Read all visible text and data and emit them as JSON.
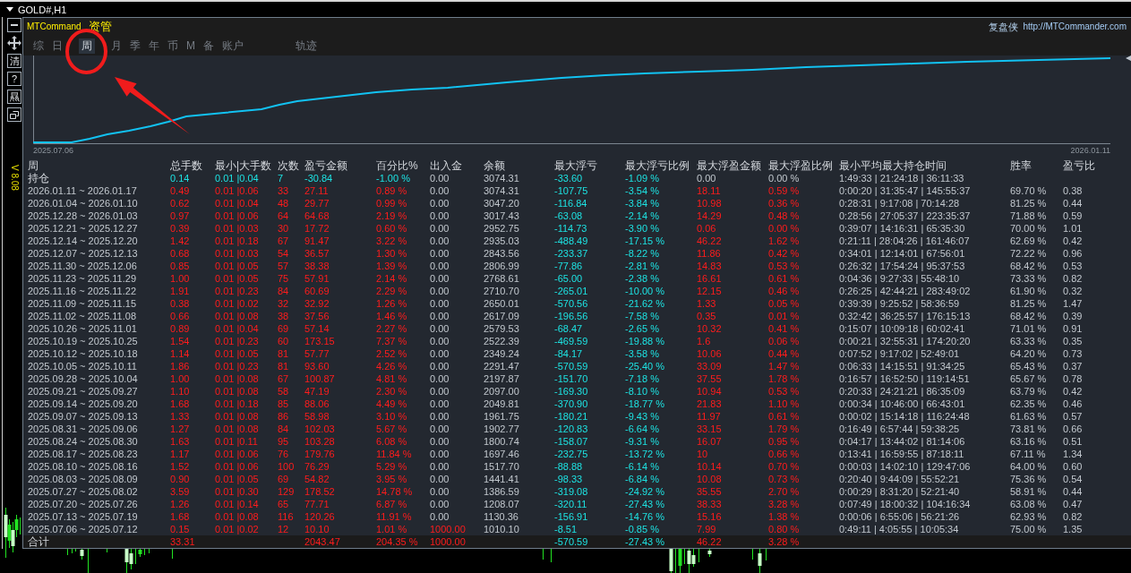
{
  "window": {
    "title": "GOLD#,H1"
  },
  "side_toolbar": {
    "buttons": [
      {
        "kind": "minimize"
      },
      {
        "kind": "move"
      },
      {
        "kind": "text",
        "label": "清"
      },
      {
        "kind": "text",
        "label": "?"
      },
      {
        "kind": "text",
        "label": "㬎"
      },
      {
        "kind": "restore"
      }
    ],
    "version": "V 8.08"
  },
  "header": {
    "app_name": "MTCommand",
    "app_name_suffix": "资管",
    "brand": "复盘侠",
    "url": "http://MTCommander.com"
  },
  "tabs": [
    {
      "label": "综",
      "selected": false
    },
    {
      "label": "日",
      "selected": false
    },
    {
      "label": "周",
      "selected": true
    },
    {
      "label": "月",
      "selected": false
    },
    {
      "label": "季",
      "selected": false
    },
    {
      "label": "年",
      "selected": false
    },
    {
      "label": "币",
      "selected": false
    },
    {
      "label": "M",
      "selected": false
    },
    {
      "label": "备",
      "selected": false
    },
    {
      "label": "账户",
      "selected": false
    }
  ],
  "chart": {
    "toggle_label": "轨迹",
    "x_start": "2025.07.06",
    "x_end": "2026.01.11"
  },
  "table": {
    "columns": [
      "周",
      "总手数",
      "最小|大手数",
      "次数",
      "盈亏金额",
      "百分比%",
      "出入金",
      "余额",
      "最大浮亏",
      "最大浮亏比例",
      "最大浮盈金额",
      "最大浮盈比例",
      "最小平均最大持仓时间",
      "胜率",
      "盈亏比"
    ],
    "rows": [
      {
        "kind": "position",
        "label": "持仓",
        "in_profit": false,
        "flow_in": false,
        "runup_gain": false,
        "lots": "0.14",
        "lot_range": "0.01 |0.04",
        "trades": "7",
        "pnl": "-30.84",
        "pct": "-1.00 %",
        "flow": "0.00",
        "balance": "3074.31",
        "dd": "-33.60",
        "dd_pct": "-1.09 %",
        "runup": "0.00",
        "runup_pct": "0.00 %",
        "hold": "1:49:33 | 21:24:18 | 36:11:33"
      },
      {
        "kind": "week",
        "label": "2026.01.11 ~ 2026.01.17",
        "in_profit": true,
        "flow_in": false,
        "runup_gain": true,
        "lots": "0.49",
        "lot_range": "0.01 |0.06",
        "trades": "33",
        "pnl": "27.11",
        "pct": "0.89 %",
        "flow": "0.00",
        "balance": "3074.31",
        "dd": "-107.75",
        "dd_pct": "-3.54 %",
        "runup": "18.11",
        "runup_pct": "0.59 %",
        "hold": "0:00:20 | 31:35:47 | 145:55:37",
        "win_rate": "69.70 %",
        "pl_ratio": "0.38"
      },
      {
        "kind": "week",
        "label": "2026.01.04 ~ 2026.01.10",
        "in_profit": true,
        "flow_in": false,
        "runup_gain": true,
        "lots": "0.62",
        "lot_range": "0.01 |0.04",
        "trades": "48",
        "pnl": "29.77",
        "pct": "0.99 %",
        "flow": "0.00",
        "balance": "3047.20",
        "dd": "-116.84",
        "dd_pct": "-3.84 %",
        "runup": "10.98",
        "runup_pct": "0.36 %",
        "hold": "0:28:31 | 9:17:08 | 70:14:28",
        "win_rate": "81.25 %",
        "pl_ratio": "0.44"
      },
      {
        "kind": "week",
        "label": "2025.12.28 ~ 2026.01.03",
        "in_profit": true,
        "flow_in": false,
        "runup_gain": true,
        "lots": "0.97",
        "lot_range": "0.01 |0.06",
        "trades": "64",
        "pnl": "64.68",
        "pct": "2.19 %",
        "flow": "0.00",
        "balance": "3017.43",
        "dd": "-63.08",
        "dd_pct": "-2.14 %",
        "runup": "14.29",
        "runup_pct": "0.48 %",
        "hold": "0:28:56 | 27:05:37 | 223:35:37",
        "win_rate": "71.88 %",
        "pl_ratio": "0.59"
      },
      {
        "kind": "week",
        "label": "2025.12.21 ~ 2025.12.27",
        "in_profit": true,
        "flow_in": false,
        "runup_gain": true,
        "lots": "0.39",
        "lot_range": "0.01 |0.03",
        "trades": "30",
        "pnl": "17.72",
        "pct": "0.60 %",
        "flow": "0.00",
        "balance": "2952.75",
        "dd": "-114.73",
        "dd_pct": "-3.90 %",
        "runup": "0.06",
        "runup_pct": "0.00 %",
        "hold": "0:39:07 | 14:16:31 | 65:35:30",
        "win_rate": "70.00 %",
        "pl_ratio": "1.01"
      },
      {
        "kind": "week",
        "label": "2025.12.14 ~ 2025.12.20",
        "in_profit": true,
        "flow_in": false,
        "runup_gain": true,
        "lots": "1.42",
        "lot_range": "0.01 |0.18",
        "trades": "67",
        "pnl": "91.47",
        "pct": "3.22 %",
        "flow": "0.00",
        "balance": "2935.03",
        "dd": "-488.49",
        "dd_pct": "-17.15 %",
        "runup": "46.22",
        "runup_pct": "1.62 %",
        "hold": "0:21:11 | 28:04:26 | 161:46:07",
        "win_rate": "62.69 %",
        "pl_ratio": "0.42"
      },
      {
        "kind": "week",
        "label": "2025.12.07 ~ 2025.12.13",
        "in_profit": true,
        "flow_in": false,
        "runup_gain": true,
        "lots": "0.68",
        "lot_range": "0.01 |0.03",
        "trades": "54",
        "pnl": "36.57",
        "pct": "1.30 %",
        "flow": "0.00",
        "balance": "2843.56",
        "dd": "-233.37",
        "dd_pct": "-8.22 %",
        "runup": "11.86",
        "runup_pct": "0.42 %",
        "hold": "0:34:01 | 12:14:01 | 67:56:01",
        "win_rate": "72.22 %",
        "pl_ratio": "0.96"
      },
      {
        "kind": "week",
        "label": "2025.11.30 ~ 2025.12.06",
        "in_profit": true,
        "flow_in": false,
        "runup_gain": true,
        "lots": "0.85",
        "lot_range": "0.01 |0.05",
        "trades": "57",
        "pnl": "38.38",
        "pct": "1.39 %",
        "flow": "0.00",
        "balance": "2806.99",
        "dd": "-77.86",
        "dd_pct": "-2.81 %",
        "runup": "14.83",
        "runup_pct": "0.53 %",
        "hold": "0:26:32 | 17:54:24 | 95:37:53",
        "win_rate": "68.42 %",
        "pl_ratio": "0.53"
      },
      {
        "kind": "week",
        "label": "2025.11.23 ~ 2025.11.29",
        "in_profit": true,
        "flow_in": false,
        "runup_gain": true,
        "lots": "1.00",
        "lot_range": "0.01 |0.05",
        "trades": "75",
        "pnl": "57.91",
        "pct": "2.14 %",
        "flow": "0.00",
        "balance": "2768.61",
        "dd": "-65.00",
        "dd_pct": "-2.38 %",
        "runup": "16.61",
        "runup_pct": "0.61 %",
        "hold": "0:04:36 | 9:27:33 | 55:48:10",
        "win_rate": "73.33 %",
        "pl_ratio": "0.82"
      },
      {
        "kind": "week",
        "label": "2025.11.16 ~ 2025.11.22",
        "in_profit": true,
        "flow_in": false,
        "runup_gain": true,
        "lots": "1.91",
        "lot_range": "0.01 |0.23",
        "trades": "84",
        "pnl": "60.69",
        "pct": "2.29 %",
        "flow": "0.00",
        "balance": "2710.70",
        "dd": "-265.01",
        "dd_pct": "-10.00 %",
        "runup": "12.15",
        "runup_pct": "0.46 %",
        "hold": "0:26:25 | 42:44:21 | 283:49:02",
        "win_rate": "61.90 %",
        "pl_ratio": "0.32"
      },
      {
        "kind": "week",
        "label": "2025.11.09 ~ 2025.11.15",
        "in_profit": true,
        "flow_in": false,
        "runup_gain": true,
        "lots": "0.38",
        "lot_range": "0.01 |0.02",
        "trades": "32",
        "pnl": "32.92",
        "pct": "1.26 %",
        "flow": "0.00",
        "balance": "2650.01",
        "dd": "-570.56",
        "dd_pct": "-21.62 %",
        "runup": "1.33",
        "runup_pct": "0.05 %",
        "hold": "0:39:39 | 9:25:52 | 58:36:59",
        "win_rate": "81.25 %",
        "pl_ratio": "1.47"
      },
      {
        "kind": "week",
        "label": "2025.11.02 ~ 2025.11.08",
        "in_profit": true,
        "flow_in": false,
        "runup_gain": true,
        "lots": "0.66",
        "lot_range": "0.01 |0.08",
        "trades": "38",
        "pnl": "37.56",
        "pct": "1.46 %",
        "flow": "0.00",
        "balance": "2617.09",
        "dd": "-196.56",
        "dd_pct": "-7.58 %",
        "runup": "0.35",
        "runup_pct": "0.01 %",
        "hold": "0:32:42 | 36:25:57 | 176:15:13",
        "win_rate": "68.42 %",
        "pl_ratio": "0.39"
      },
      {
        "kind": "week",
        "label": "2025.10.26 ~ 2025.11.01",
        "in_profit": true,
        "flow_in": false,
        "runup_gain": true,
        "lots": "0.89",
        "lot_range": "0.01 |0.04",
        "trades": "69",
        "pnl": "57.14",
        "pct": "2.27 %",
        "flow": "0.00",
        "balance": "2579.53",
        "dd": "-68.47",
        "dd_pct": "-2.65 %",
        "runup": "10.32",
        "runup_pct": "0.41 %",
        "hold": "0:15:07 | 10:09:18 | 60:02:41",
        "win_rate": "71.01 %",
        "pl_ratio": "0.91"
      },
      {
        "kind": "week",
        "label": "2025.10.19 ~ 2025.10.25",
        "in_profit": true,
        "flow_in": false,
        "runup_gain": true,
        "lots": "1.54",
        "lot_range": "0.01 |0.23",
        "trades": "60",
        "pnl": "173.15",
        "pct": "7.37 %",
        "flow": "0.00",
        "balance": "2522.39",
        "dd": "-469.59",
        "dd_pct": "-19.88 %",
        "runup": "1.6",
        "runup_pct": "0.06 %",
        "hold": "0:00:21 | 32:55:31 | 174:20:20",
        "win_rate": "63.33 %",
        "pl_ratio": "0.35"
      },
      {
        "kind": "week",
        "label": "2025.10.12 ~ 2025.10.18",
        "in_profit": true,
        "flow_in": false,
        "runup_gain": true,
        "lots": "1.14",
        "lot_range": "0.01 |0.05",
        "trades": "81",
        "pnl": "57.77",
        "pct": "2.52 %",
        "flow": "0.00",
        "balance": "2349.24",
        "dd": "-84.17",
        "dd_pct": "-3.58 %",
        "runup": "10.06",
        "runup_pct": "0.44 %",
        "hold": "0:07:52 | 9:17:02 | 52:49:01",
        "win_rate": "64.20 %",
        "pl_ratio": "0.73"
      },
      {
        "kind": "week",
        "label": "2025.10.05 ~ 2025.10.11",
        "in_profit": true,
        "flow_in": false,
        "runup_gain": true,
        "lots": "1.86",
        "lot_range": "0.01 |0.23",
        "trades": "81",
        "pnl": "93.60",
        "pct": "4.26 %",
        "flow": "0.00",
        "balance": "2291.47",
        "dd": "-570.59",
        "dd_pct": "-25.40 %",
        "runup": "33.09",
        "runup_pct": "1.47 %",
        "hold": "0:06:33 | 14:15:51 | 91:34:25",
        "win_rate": "65.43 %",
        "pl_ratio": "0.37"
      },
      {
        "kind": "week",
        "label": "2025.09.28 ~ 2025.10.04",
        "in_profit": true,
        "flow_in": false,
        "runup_gain": true,
        "lots": "1.00",
        "lot_range": "0.01 |0.08",
        "trades": "67",
        "pnl": "100.87",
        "pct": "4.81 %",
        "flow": "0.00",
        "balance": "2197.87",
        "dd": "-151.70",
        "dd_pct": "-7.18 %",
        "runup": "37.55",
        "runup_pct": "1.78 %",
        "hold": "0:16:57 | 16:52:50 | 119:14:51",
        "win_rate": "65.67 %",
        "pl_ratio": "0.78"
      },
      {
        "kind": "week",
        "label": "2025.09.21 ~ 2025.09.27",
        "in_profit": true,
        "flow_in": false,
        "runup_gain": true,
        "lots": "1.10",
        "lot_range": "0.01 |0.08",
        "trades": "58",
        "pnl": "47.19",
        "pct": "2.30 %",
        "flow": "0.00",
        "balance": "2097.00",
        "dd": "-169.30",
        "dd_pct": "-8.10 %",
        "runup": "10.94",
        "runup_pct": "0.53 %",
        "hold": "0:20:33 | 24:21:21 | 86:35:09",
        "win_rate": "63.79 %",
        "pl_ratio": "0.42"
      },
      {
        "kind": "week",
        "label": "2025.09.14 ~ 2025.09.20",
        "in_profit": true,
        "flow_in": false,
        "runup_gain": true,
        "lots": "1.68",
        "lot_range": "0.01 |0.18",
        "trades": "85",
        "pnl": "88.06",
        "pct": "4.49 %",
        "flow": "0.00",
        "balance": "2049.81",
        "dd": "-370.90",
        "dd_pct": "-18.77 %",
        "runup": "21.83",
        "runup_pct": "1.10 %",
        "hold": "0:00:34 | 10:46:00 | 66:43:01",
        "win_rate": "62.35 %",
        "pl_ratio": "0.46"
      },
      {
        "kind": "week",
        "label": "2025.09.07 ~ 2025.09.13",
        "in_profit": true,
        "flow_in": false,
        "runup_gain": true,
        "lots": "1.33",
        "lot_range": "0.01 |0.08",
        "trades": "86",
        "pnl": "58.98",
        "pct": "3.10 %",
        "flow": "0.00",
        "balance": "1961.75",
        "dd": "-180.21",
        "dd_pct": "-9.43 %",
        "runup": "11.97",
        "runup_pct": "0.61 %",
        "hold": "0:00:02 | 15:14:18 | 116:24:48",
        "win_rate": "61.63 %",
        "pl_ratio": "0.57"
      },
      {
        "kind": "week",
        "label": "2025.08.31 ~ 2025.09.06",
        "in_profit": true,
        "flow_in": false,
        "runup_gain": true,
        "lots": "1.27",
        "lot_range": "0.01 |0.08",
        "trades": "84",
        "pnl": "102.03",
        "pct": "5.67 %",
        "flow": "0.00",
        "balance": "1902.77",
        "dd": "-120.83",
        "dd_pct": "-6.64 %",
        "runup": "33.15",
        "runup_pct": "1.79 %",
        "hold": "0:16:49 | 6:57:44 | 59:38:25",
        "win_rate": "73.81 %",
        "pl_ratio": "0.66"
      },
      {
        "kind": "week",
        "label": "2025.08.24 ~ 2025.08.30",
        "in_profit": true,
        "flow_in": false,
        "runup_gain": true,
        "lots": "1.63",
        "lot_range": "0.01 |0.11",
        "trades": "95",
        "pnl": "103.28",
        "pct": "6.08 %",
        "flow": "0.00",
        "balance": "1800.74",
        "dd": "-158.07",
        "dd_pct": "-9.31 %",
        "runup": "16.07",
        "runup_pct": "0.95 %",
        "hold": "0:04:17 | 13:44:02 | 81:14:06",
        "win_rate": "63.16 %",
        "pl_ratio": "0.51"
      },
      {
        "kind": "week",
        "label": "2025.08.17 ~ 2025.08.23",
        "in_profit": true,
        "flow_in": false,
        "runup_gain": true,
        "lots": "1.17",
        "lot_range": "0.01 |0.06",
        "trades": "76",
        "pnl": "179.76",
        "pct": "11.84 %",
        "flow": "0.00",
        "balance": "1697.46",
        "dd": "-232.75",
        "dd_pct": "-13.72 %",
        "runup": "10",
        "runup_pct": "0.66 %",
        "hold": "0:13:41 | 16:59:55 | 87:18:11",
        "win_rate": "67.11 %",
        "pl_ratio": "1.34"
      },
      {
        "kind": "week",
        "label": "2025.08.10 ~ 2025.08.16",
        "in_profit": true,
        "flow_in": false,
        "runup_gain": true,
        "lots": "1.52",
        "lot_range": "0.01 |0.06",
        "trades": "100",
        "pnl": "76.29",
        "pct": "5.29 %",
        "flow": "0.00",
        "balance": "1517.70",
        "dd": "-88.88",
        "dd_pct": "-6.14 %",
        "runup": "10.14",
        "runup_pct": "0.70 %",
        "hold": "0:00:03 | 14:02:10 | 129:47:06",
        "win_rate": "64.00 %",
        "pl_ratio": "0.60"
      },
      {
        "kind": "week",
        "label": "2025.08.03 ~ 2025.08.09",
        "in_profit": true,
        "flow_in": false,
        "runup_gain": true,
        "lots": "0.90",
        "lot_range": "0.01 |0.05",
        "trades": "69",
        "pnl": "54.82",
        "pct": "3.95 %",
        "flow": "0.00",
        "balance": "1441.41",
        "dd": "-98.33",
        "dd_pct": "-6.84 %",
        "runup": "10.08",
        "runup_pct": "0.73 %",
        "hold": "0:20:40 | 9:44:09 | 55:52:21",
        "win_rate": "75.36 %",
        "pl_ratio": "0.54"
      },
      {
        "kind": "week",
        "label": "2025.07.27 ~ 2025.08.02",
        "in_profit": true,
        "flow_in": false,
        "runup_gain": true,
        "lots": "3.59",
        "lot_range": "0.01 |0.30",
        "trades": "129",
        "pnl": "178.52",
        "pct": "14.78 %",
        "flow": "0.00",
        "balance": "1386.59",
        "dd": "-319.08",
        "dd_pct": "-24.92 %",
        "runup": "35.55",
        "runup_pct": "2.70 %",
        "hold": "0:00:29 | 8:31:20 | 52:21:40",
        "win_rate": "58.91 %",
        "pl_ratio": "0.44"
      },
      {
        "kind": "week",
        "label": "2025.07.20 ~ 2025.07.26",
        "in_profit": true,
        "flow_in": false,
        "runup_gain": true,
        "lots": "1.26",
        "lot_range": "0.01 |0.14",
        "trades": "65",
        "pnl": "77.71",
        "pct": "6.87 %",
        "flow": "0.00",
        "balance": "1208.07",
        "dd": "-320.11",
        "dd_pct": "-27.43 %",
        "runup": "38.33",
        "runup_pct": "3.28 %",
        "hold": "0:07:49 | 18:00:32 | 104:16:34",
        "win_rate": "63.08 %",
        "pl_ratio": "0.47"
      },
      {
        "kind": "week",
        "label": "2025.07.13 ~ 2025.07.19",
        "in_profit": true,
        "flow_in": false,
        "runup_gain": true,
        "lots": "1.68",
        "lot_range": "0.01 |0.08",
        "trades": "116",
        "pnl": "120.26",
        "pct": "11.91 %",
        "flow": "0.00",
        "balance": "1130.36",
        "dd": "-156.91",
        "dd_pct": "-14.76 %",
        "runup": "15.16",
        "runup_pct": "1.38 %",
        "hold": "0:00:06 | 6:55:06 | 56:21:26",
        "win_rate": "62.93 %",
        "pl_ratio": "0.82"
      },
      {
        "kind": "week",
        "label": "2025.07.06 ~ 2025.07.12",
        "in_profit": true,
        "flow_in": true,
        "runup_gain": true,
        "lots": "0.15",
        "lot_range": "0.01 |0.02",
        "trades": "12",
        "pnl": "10.10",
        "pct": "1.01 %",
        "flow": "1000.00",
        "balance": "1010.10",
        "dd": "-8.51",
        "dd_pct": "-0.85 %",
        "runup": "7.99",
        "runup_pct": "0.80 %",
        "hold": "0:49:11 | 4:05:55 | 10:05:34",
        "win_rate": "75.00 %",
        "pl_ratio": "1.35"
      },
      {
        "kind": "total",
        "label": "合计",
        "in_profit": true,
        "flow_in": true,
        "runup_gain": true,
        "lots": "33.31",
        "pnl": "2043.47",
        "pct": "204.35 %",
        "flow": "1000.00",
        "dd": "-570.59",
        "dd_pct": "-27.43 %",
        "runup": "46.22",
        "runup_pct": "3.28 %"
      }
    ]
  }
}
